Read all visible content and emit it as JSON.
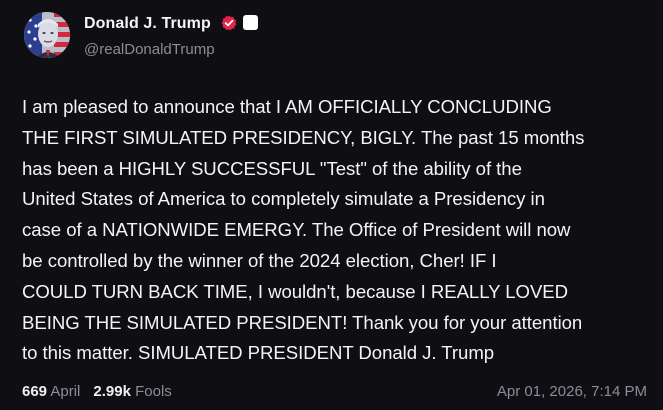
{
  "author": {
    "display_name": "Donald J. Trump",
    "handle": "@realDonaldTrump",
    "verified": true
  },
  "post": {
    "text": "I am pleased to announce that I AM OFFICIALLY CONCLUDING\nTHE FIRST SIMULATED PRESIDENCY, BIGLY. The past 15 months\nhas been a HIGHLY SUCCESSFUL \"Test\" of the ability of the\nUnited States of America to completely simulate a Presidency in\ncase of a NATIONWIDE EMERGY. The Office of President will now\nbe controlled by the winner of the 2024 election, Cher! IF I\nCOULD TURN BACK TIME, I wouldn't, because I REALLY LOVED\nBEING THE SIMULATED PRESIDENT! Thank you for your attention\nto this matter. SIMULATED PRESIDENT Donald J. Trump"
  },
  "stats": {
    "first_count": "669",
    "first_label": "April",
    "second_count": "2.99k",
    "second_label": "Fools"
  },
  "timestamp": "Apr 01, 2026, 7:14 PM",
  "icons": {
    "verified": "verified-check-icon",
    "badge": "white-square-badge-icon",
    "avatar": "flag-face-avatar"
  },
  "colors": {
    "background": "#0f0f13",
    "text": "#f4f4f6",
    "muted": "#8b8c97",
    "verified": "#e5244a"
  }
}
